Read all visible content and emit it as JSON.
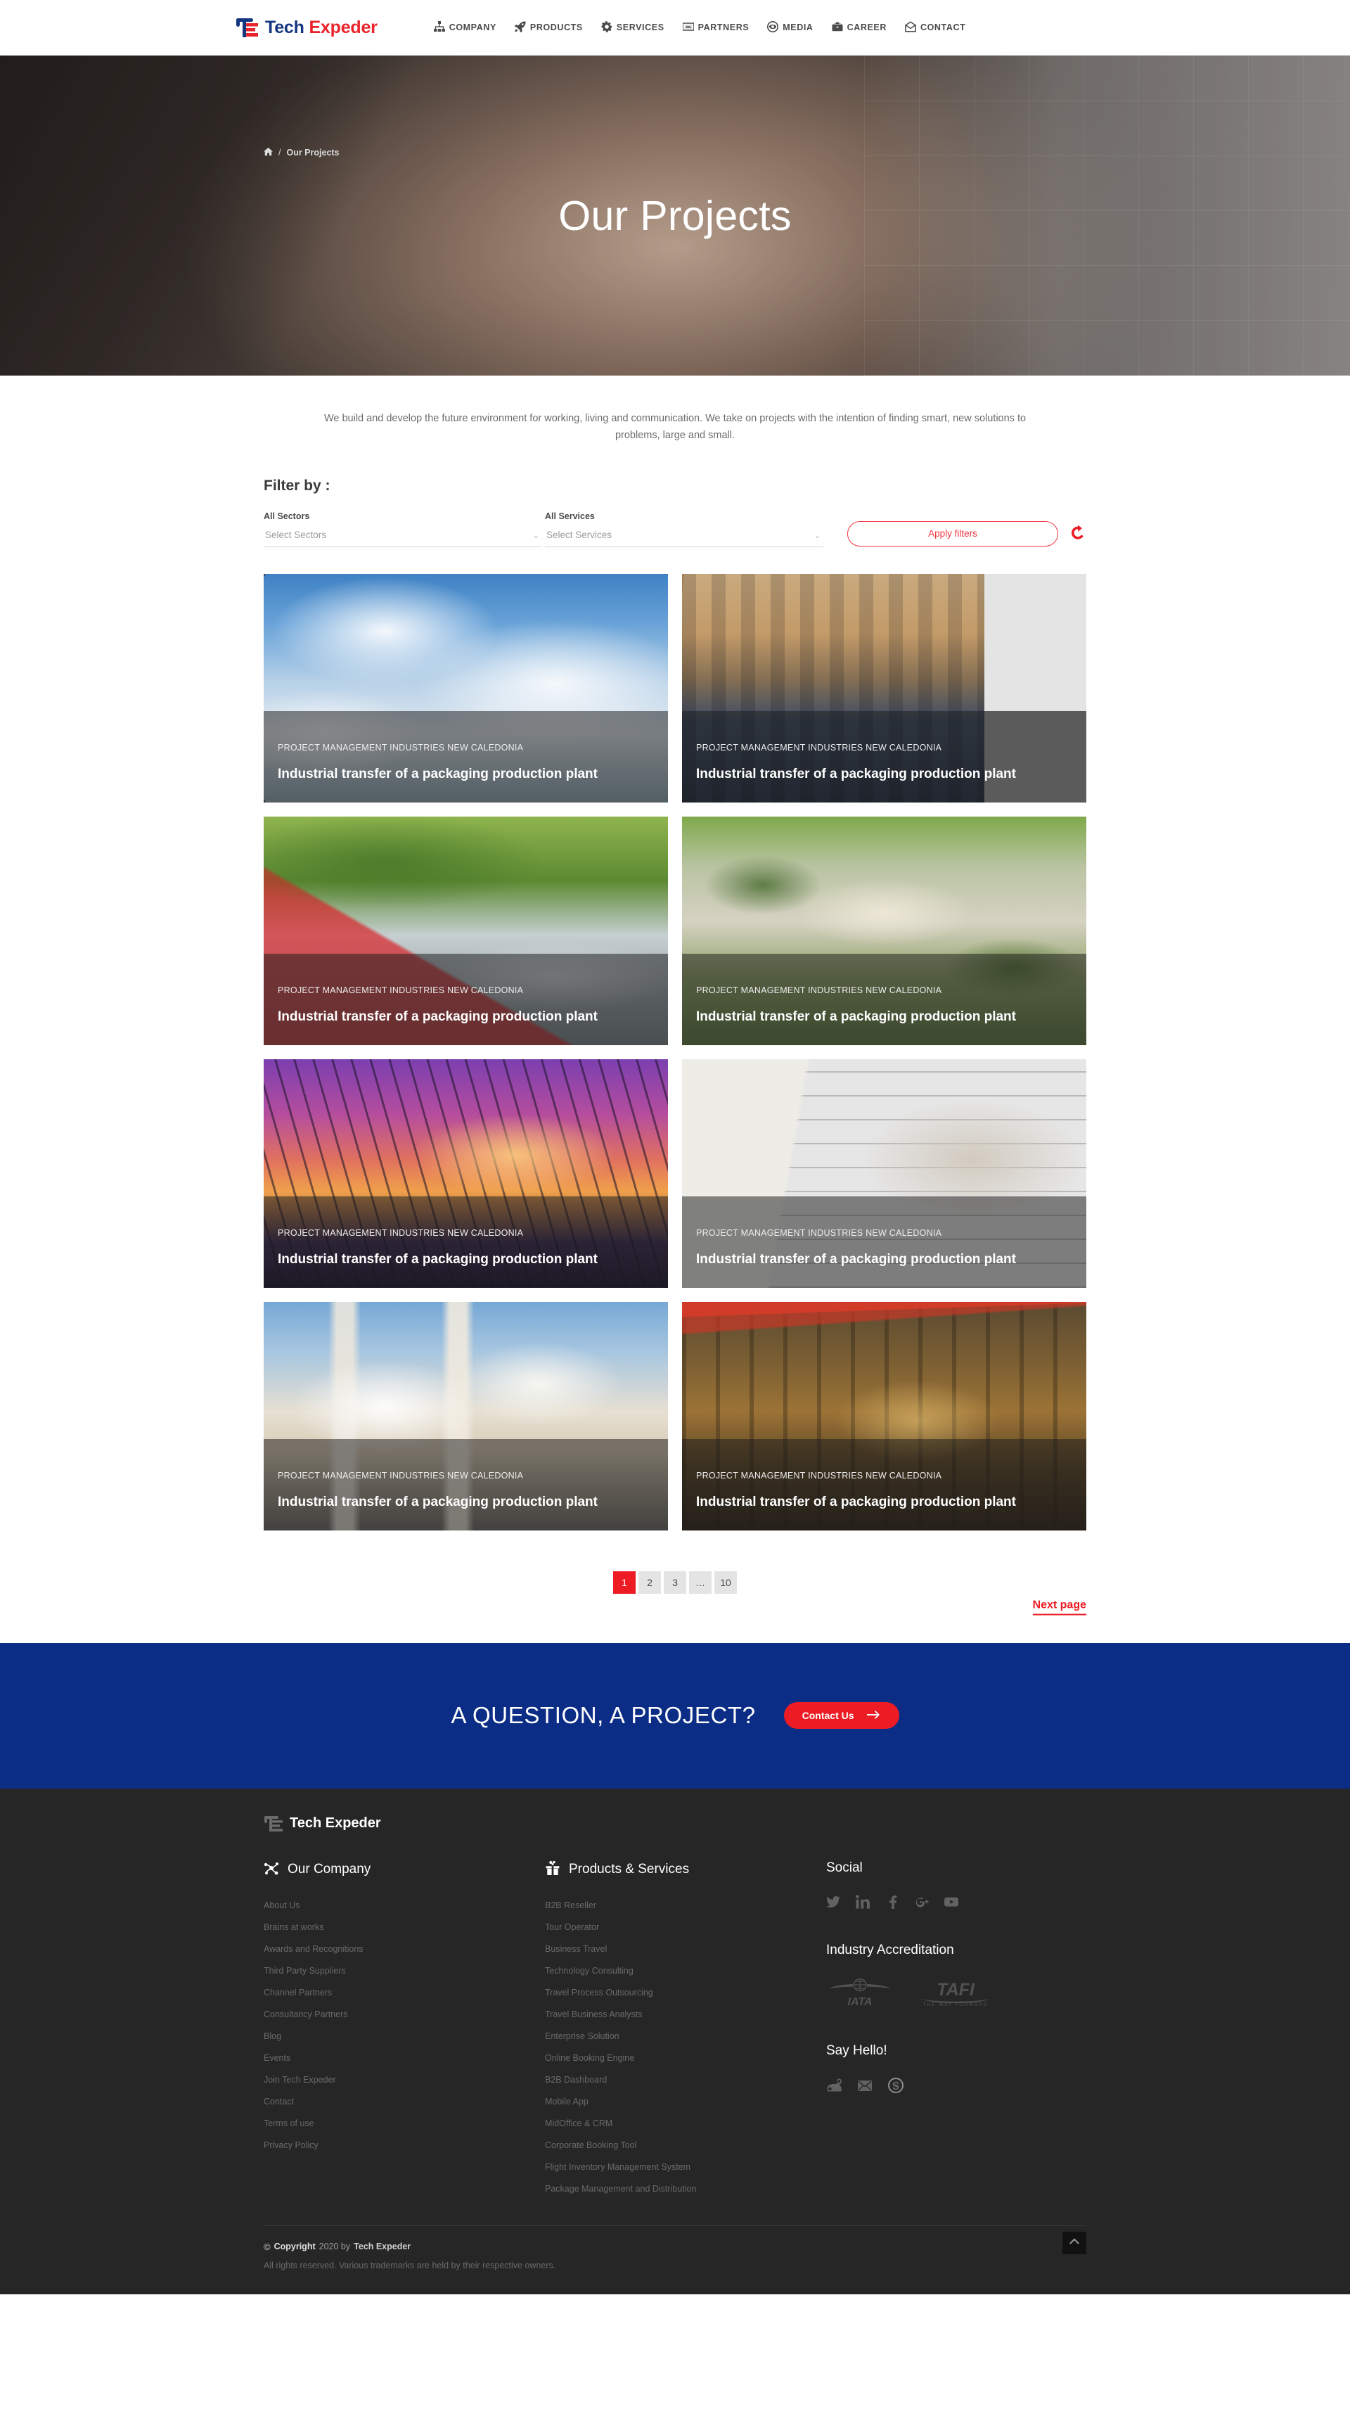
{
  "brand": {
    "name_part1": "Tech ",
    "name_part2": "Expeder",
    "footer_name": "Tech Expeder",
    "accent_red": "#ed1c24",
    "accent_blue": "#15377f",
    "cta_blue": "#0c2d86"
  },
  "nav": {
    "items": [
      {
        "label": "COMPANY",
        "icon": "sitemap-icon"
      },
      {
        "label": "PRODUCTS",
        "icon": "rocket-icon"
      },
      {
        "label": "SERVICES",
        "icon": "gear-icon"
      },
      {
        "label": "PARTNERS",
        "icon": "handshake-icon"
      },
      {
        "label": "MEDIA",
        "icon": "eye-icon"
      },
      {
        "label": "CAREER",
        "icon": "briefcase-icon"
      },
      {
        "label": "CONTACT",
        "icon": "envelope-open-icon"
      }
    ]
  },
  "hero": {
    "title": "Our Projects",
    "breadcrumb_home_icon": "home-icon",
    "breadcrumb_sep": "/",
    "breadcrumb_current": "Our Projects"
  },
  "intro": {
    "text": "We build and develop the future environment for working, living and communication. We take on projects with the intention of finding smart, new solutions to problems, large and small."
  },
  "filters": {
    "heading": "Filter by :",
    "sectors_label": "All Sectors",
    "sectors_placeholder": "Select Sectors",
    "services_label": "All Services",
    "services_placeholder": "Select Services",
    "apply_label": "Apply filters",
    "reset_icon": "refresh-icon"
  },
  "projects": [
    {
      "category": "PROJECT MANAGEMENT INDUSTRIES NEW CALEDONIA",
      "title": "Industrial transfer of a packaging production plant",
      "photo": "ph1",
      "narrow": false
    },
    {
      "category": "PROJECT MANAGEMENT INDUSTRIES NEW CALEDONIA",
      "title": "Industrial transfer of a packaging production plant",
      "photo": "ph2",
      "narrow": true
    },
    {
      "category": "PROJECT MANAGEMENT INDUSTRIES NEW CALEDONIA",
      "title": "Industrial transfer of a packaging production plant",
      "photo": "ph3",
      "narrow": false
    },
    {
      "category": "PROJECT MANAGEMENT INDUSTRIES NEW CALEDONIA",
      "title": "Industrial transfer of a packaging production plant",
      "photo": "ph4",
      "narrow": false
    },
    {
      "category": "PROJECT MANAGEMENT INDUSTRIES NEW CALEDONIA",
      "title": "Industrial transfer of a packaging production plant",
      "photo": "ph5",
      "narrow": false
    },
    {
      "category": "PROJECT MANAGEMENT INDUSTRIES NEW CALEDONIA",
      "title": "Industrial transfer of a packaging production plant",
      "photo": "ph6",
      "narrow": false
    },
    {
      "category": "PROJECT MANAGEMENT INDUSTRIES NEW CALEDONIA",
      "title": "Industrial transfer of a packaging production plant",
      "photo": "ph7",
      "narrow": false
    },
    {
      "category": "PROJECT MANAGEMENT INDUSTRIES NEW CALEDONIA",
      "title": "Industrial transfer of a packaging production plant",
      "photo": "ph8",
      "narrow": false
    }
  ],
  "pagination": {
    "pages": [
      "1",
      "2",
      "3",
      "…",
      "10"
    ],
    "active_index": 0,
    "next_label": "Next page"
  },
  "cta": {
    "heading": "A QUESTION, A PROJECT?",
    "button_label": "Contact Us",
    "button_icon": "arrow-right-icon"
  },
  "footer": {
    "company": {
      "title": "Our Company",
      "icon": "network-nodes-icon",
      "links": [
        "About Us",
        "Brains at works",
        "Awards and Recognitions",
        "Third Party Suppliers",
        "Channel Partners",
        "Consultancy Partners",
        "Blog",
        "Events",
        "Join Tech Expeder",
        "Contact",
        "Terms of use",
        "Privacy Policy"
      ]
    },
    "products": {
      "title": "Products & Services",
      "icon": "gift-box-icon",
      "links": [
        "B2B Reseller",
        "Tour Operator",
        "Business Travel",
        "Technology Consulting",
        "Travel Process Outsourcing",
        "Travel Business Analysts",
        "Enterprise Solution",
        "Online Booking Engine",
        "B2B Dashboard",
        "Mobile App",
        "MidOffice & CRM",
        "Corporate Booking Tool",
        "Flight Inventory Management System",
        "Package Management and Distribution"
      ]
    },
    "social": {
      "title": "Social",
      "icons": [
        "twitter-icon",
        "linkedin-icon",
        "facebook-icon",
        "google-plus-icon",
        "youtube-icon"
      ]
    },
    "accreditation": {
      "title": "Industry Accreditation",
      "logos": [
        {
          "name": "iata-logo",
          "text": "IATA"
        },
        {
          "name": "tafi-logo",
          "text": "TAFI",
          "tagline": "THE WAY FORWARD"
        }
      ]
    },
    "hello": {
      "title": "Say Hello!",
      "icons": [
        "phone-icon",
        "email-icon",
        "skype-icon"
      ]
    },
    "copyright": {
      "symbol": "©",
      "bold": "Copyright",
      "year_by": "2020 by",
      "brand": "Tech Expeder",
      "rights": "All rights reserved. Various trademarks are held by their respective owners."
    },
    "back_to_top_icon": "chevron-up-icon"
  }
}
